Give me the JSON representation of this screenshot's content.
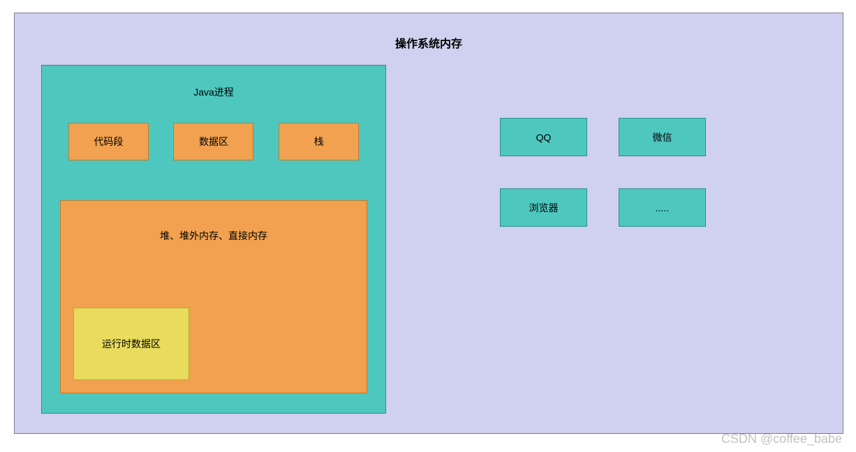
{
  "os_memory": {
    "title": "操作系统内存"
  },
  "java_process": {
    "title": "Java进程",
    "segments": {
      "code": "代码段",
      "data": "数据区",
      "stack": "栈"
    },
    "heap": {
      "title": "堆、堆外内存、直接内存",
      "runtime_data": "运行时数据区"
    }
  },
  "other_apps": {
    "qq": "QQ",
    "wechat": "微信",
    "browser": "浏览器",
    "etc": "....."
  },
  "watermark": "CSDN @coffee_babe"
}
